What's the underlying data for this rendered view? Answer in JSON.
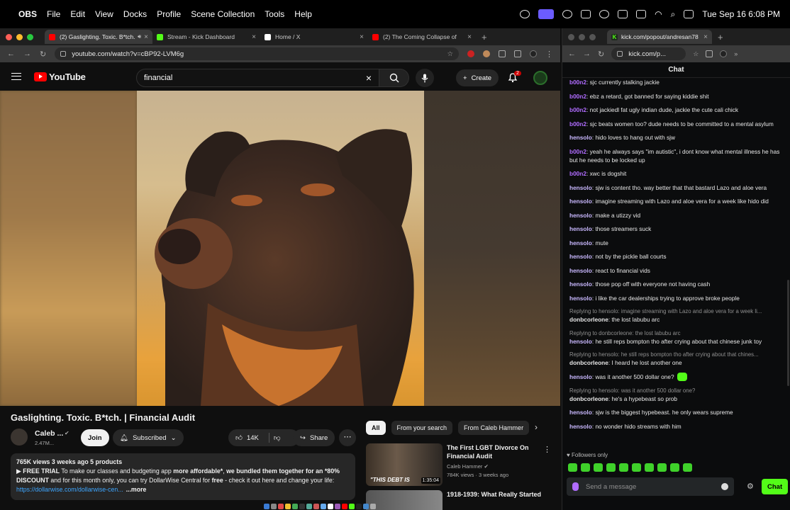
{
  "menubar": {
    "app": "OBS",
    "items": [
      "File",
      "Edit",
      "View",
      "Docks",
      "Profile",
      "Scene Collection",
      "Tools",
      "Help"
    ],
    "clock": "Tue Sep 16  6:08 PM"
  },
  "left_browser": {
    "tabs": [
      {
        "title": "(2) Gaslighting. Toxic. B*tch.",
        "favicon_color": "#ff0000",
        "active": true,
        "audio": true
      },
      {
        "title": "Stream - Kick Dashboard",
        "favicon_color": "#53fc18",
        "active": false
      },
      {
        "title": "Home / X",
        "favicon_color": "#ffffff",
        "active": false
      },
      {
        "title": "(2) The Coming Collapse of",
        "favicon_color": "#ff0000",
        "active": false
      }
    ],
    "url": "youtube.com/watch?v=cBP92-LVM6g"
  },
  "youtube": {
    "logo": "YouTube",
    "search_value": "financial",
    "create_label": "Create",
    "notif_count": "2",
    "video_title": "Gaslighting. Toxic. B*tch. | Financial Audit",
    "channel_name": "Caleb ...",
    "subscribers": "2.47M...",
    "join_label": "Join",
    "subscribed_label": "Subscribed",
    "likes": "14K",
    "share_label": "Share",
    "description": {
      "meta": "765K views  3 weeks ago  5 products",
      "line1_a": "▶ ",
      "line1_b": "FREE TRIAL",
      "line1_c": " To make our classes and budgeting app ",
      "line1_d": "more affordable*",
      "line1_e": ", ",
      "line1_f": "we bundled them together for an *80%",
      "line2_a": "DISCOUNT",
      "line2_b": " and for this month only, you can try DollarWise Central for ",
      "line2_c": "free",
      "line2_d": " - check it out here and change your life:",
      "link": "https://dollarwise.com/dollarwise-cen...",
      "more": "...more"
    },
    "chips": [
      "All",
      "From your search",
      "From Caleb Hammer"
    ],
    "recommendations": [
      {
        "title": "The First LGBT Divorce On Financial Audit",
        "channel": "Caleb Hammer",
        "meta": "784K views · 3 weeks ago",
        "thumb_text": "\"THIS DEBT IS",
        "duration": "1:35:04"
      },
      {
        "title": "1918-1939: What Really Started",
        "channel": "",
        "meta": "",
        "thumb_text": "",
        "duration": ""
      }
    ]
  },
  "right_browser": {
    "tab_title": "kick.com/popout/andresan78",
    "url": "kick.com/p...",
    "chat_title": "Chat",
    "messages": [
      {
        "user": "b00n2",
        "color": "#b06cff",
        "text": "sjc currently stalking jackie"
      },
      {
        "user": "b00n2",
        "color": "#b06cff",
        "text": "ebz a retard, got banned for saying kiddie shit"
      },
      {
        "user": "b00n2",
        "color": "#b06cff",
        "text": "not jackiedl fat ugly indian dude, jackie the cute cali chick"
      },
      {
        "user": "b00n2",
        "color": "#b06cff",
        "text": "sjc beats women too? dude needs to be committed to a mental asylum"
      },
      {
        "user": "hensolo",
        "color": "#c9b8ff",
        "text": "hido loves to hang out with sjw"
      },
      {
        "user": "b00n2",
        "color": "#b06cff",
        "text": "yeah he always says \"im autistic\", i dont know what mental illness he has but he needs to be locked up"
      },
      {
        "user": "b00n2",
        "color": "#b06cff",
        "text": "xwc is dogshit"
      },
      {
        "user": "hensolo",
        "color": "#c9b8ff",
        "text": "sjw is content tho. way better that that bastard Lazo and aloe vera"
      },
      {
        "user": "hensolo",
        "color": "#c9b8ff",
        "text": "imagine streaming with Lazo and aloe vera for a week like hido did"
      },
      {
        "user": "hensolo",
        "color": "#c9b8ff",
        "text": "make a utizzy vid"
      },
      {
        "user": "hensolo",
        "color": "#c9b8ff",
        "text": "those streamers suck"
      },
      {
        "user": "hensolo",
        "color": "#c9b8ff",
        "text": "mute"
      },
      {
        "user": "hensolo",
        "color": "#c9b8ff",
        "text": "not by the pickle ball courts"
      },
      {
        "user": "hensolo",
        "color": "#c9b8ff",
        "text": "react to financial vids"
      },
      {
        "user": "hensolo",
        "color": "#c9b8ff",
        "text": "those pop off with everyone not having cash"
      },
      {
        "user": "hensolo",
        "color": "#c9b8ff",
        "text": "i like the car dealerships trying to approve broke people"
      },
      {
        "reply": "Replying to hensolo: imagine streaming with Lazo and aloe vera for a week li...",
        "user": "donbcorleone",
        "color": "#e6e6e6",
        "text": "the lost labubu arc"
      },
      {
        "reply": "Replying to donbcorleone: the lost labubu arc",
        "user": "hensolo",
        "color": "#c9b8ff",
        "text": "he still reps bompton tho after crying about that chinese junk toy"
      },
      {
        "reply": "Replying to hensolo: he still reps bompton tho after crying about that chines...",
        "user": "donbcorleone",
        "color": "#e6e6e6",
        "text": "I heard he lost another one"
      },
      {
        "user": "hensolo",
        "color": "#c9b8ff",
        "text": "was it another 500 dollar one?",
        "emote": true
      },
      {
        "reply": "Replying to hensolo: was it another 500 dollar one?",
        "user": "donbcorleone",
        "color": "#e6e6e6",
        "text": "he's a hypebeast so prob"
      },
      {
        "user": "hensolo",
        "color": "#c9b8ff",
        "text": "sjw is the biggest hypebeast. he only wears supreme"
      },
      {
        "user": "hensolo",
        "color": "#c9b8ff",
        "text": "no wonder hido streams with him"
      }
    ],
    "followers_label": "Followers only",
    "send_placeholder": "Send a message",
    "chat_button": "Chat"
  }
}
